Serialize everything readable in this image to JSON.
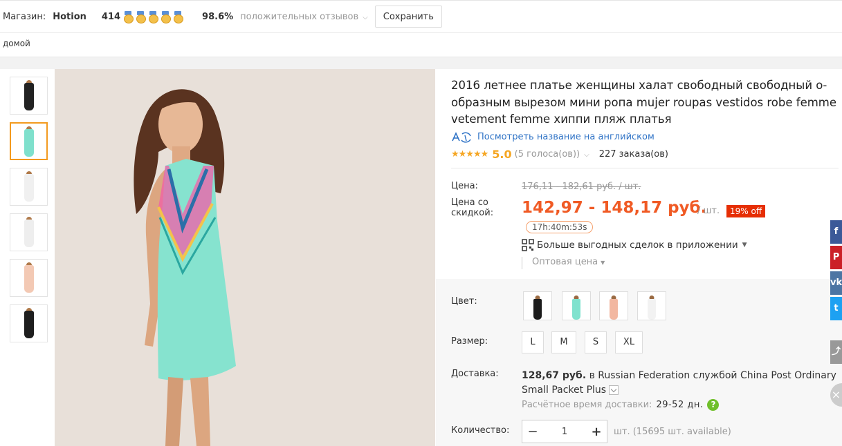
{
  "store": {
    "label": "Магазин:",
    "name": "Hotion",
    "score": "414",
    "medal_count": 5,
    "positive_pct": "98.6%",
    "positive_label": "положительных отзывов",
    "save_label": "Сохранить"
  },
  "breadcrumb": {
    "home": "домой"
  },
  "thumbnails": [
    {
      "icon": "black-dress-thumb",
      "color": "#222222"
    },
    {
      "icon": "mint-dress-thumb",
      "color": "#7fe0cc",
      "active": true
    },
    {
      "icon": "white-pattern-dress-thumb",
      "color": "#f0f0f0"
    },
    {
      "icon": "white-pattern-dress-thumb",
      "color": "#eeeeee"
    },
    {
      "icon": "peach-dress-back-thumb",
      "color": "#f3c9b4"
    },
    {
      "icon": "black-dress-side-thumb",
      "color": "#1e1e1e"
    }
  ],
  "product": {
    "title": "2016 летнее платье женщины халат свободный свободный о-образным вырезом мини ропа mujer roupas vestidos robe femme vetement femme хиппи пляж платья",
    "translate_link": "Посмотреть название на английском",
    "stars": "★★★★★",
    "rating": "5.0",
    "votes": "(5 голоса(ов))",
    "orders": "227 заказа(ов)"
  },
  "price": {
    "label": "Цена:",
    "old": "176,11 - 182,61 руб. / шт.",
    "discount_label": "Цена со скидкой:",
    "new": "142,97 - 148,17 руб.",
    "unit": "/ шт.",
    "off_badge": "19% off",
    "timer": "17h:40m:53s",
    "app_deals": "Больше выгодных сделок в приложении",
    "wholesale": "Оптовая цена"
  },
  "options": {
    "color_label": "Цвет:",
    "colors": [
      {
        "name": "black",
        "color": "#1c1c1c"
      },
      {
        "name": "mint",
        "color": "#80e2ce"
      },
      {
        "name": "peach",
        "color": "#f2b7a0"
      },
      {
        "name": "white",
        "color": "#f2f2f2"
      }
    ],
    "size_label": "Размер:",
    "sizes": [
      "L",
      "M",
      "S",
      "XL"
    ],
    "shipping_label": "Доставка:",
    "shipping_price": "128,67 руб.",
    "shipping_text": " в Russian Federation службой China Post Ordinary Small Packet Plus",
    "est_label": "Расчётное время доставки:",
    "est_days": "29-52 дн.",
    "qty_label": "Количество:",
    "qty_value": "1",
    "qty_minus": "−",
    "qty_plus": "+",
    "available": "шт. (15695 шт. available)"
  },
  "social": [
    {
      "name": "facebook",
      "glyph": "f",
      "color": "#3b5998"
    },
    {
      "name": "pinterest",
      "glyph": "P",
      "color": "#cb2027"
    },
    {
      "name": "vk",
      "glyph": "vk",
      "color": "#4c75a3"
    },
    {
      "name": "twitter",
      "glyph": "t",
      "color": "#1da1f2"
    },
    {
      "name": "share",
      "glyph": "⤴",
      "color": "#999999"
    }
  ],
  "colors": {
    "accent": "#f05a24",
    "link": "#2f73c6",
    "badge": "#e62e04",
    "star": "#f5a623"
  }
}
